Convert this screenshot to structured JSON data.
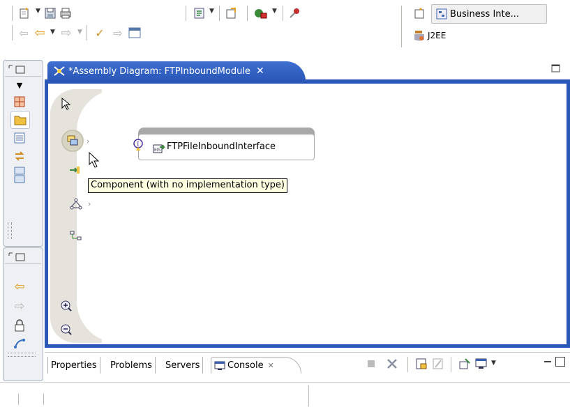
{
  "toolbar": {
    "perspectives": [
      {
        "label": "Business Inte...",
        "icon": "business-integration-perspective-icon"
      },
      {
        "label": "J2EE",
        "icon": "j2ee-perspective-icon"
      }
    ]
  },
  "editor": {
    "tab_title": "*Assembly Diagram: FTPInboundModule",
    "component_label": "FTPFileInboundInterface",
    "tooltip": "Component (with no implementation type)"
  },
  "bottom_tabs": [
    {
      "label": "Properties"
    },
    {
      "label": "Problems"
    },
    {
      "label": "Servers"
    },
    {
      "label": "Console",
      "active": true
    }
  ],
  "colors": {
    "editor_accent": "#2a57b8",
    "palette_bg": "#e6e3dc",
    "tooltip_bg": "#ffffe1"
  }
}
